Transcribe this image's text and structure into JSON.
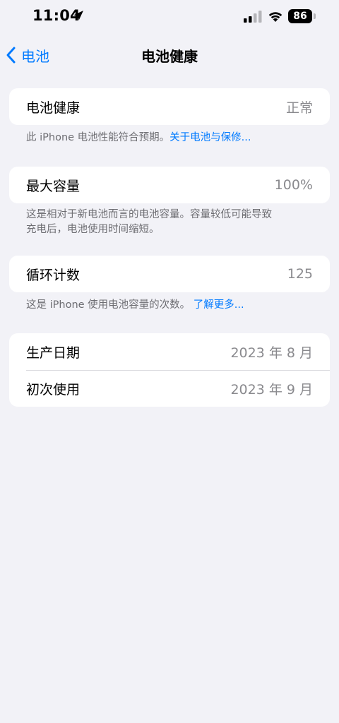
{
  "status_bar": {
    "time": "11:04",
    "battery_level": "86"
  },
  "nav": {
    "back_label": "电池",
    "title": "电池健康"
  },
  "sections": {
    "health": {
      "label": "电池健康",
      "value": "正常",
      "footer_text": "此 iPhone 电池性能符合预期。",
      "footer_link": "关于电池与保修..."
    },
    "capacity": {
      "label": "最大容量",
      "value": "100%",
      "footer_line1": "这是相对于新电池而言的电池容量。容量较低可能导致",
      "footer_line2": "充电后，电池使用时间缩短。"
    },
    "cycle": {
      "label": "循环计数",
      "value": "125",
      "footer_text": "这是 iPhone 使用电池容量的次数。",
      "footer_link": "了解更多..."
    },
    "dates": {
      "manufacture_label": "生产日期",
      "manufacture_value": "2023 年 8 月",
      "first_use_label": "初次使用",
      "first_use_value": "2023 年 9 月"
    }
  },
  "colors": {
    "accent": "#007aff",
    "background": "#f2f2f7",
    "secondary_text": "#8a8a8e"
  }
}
